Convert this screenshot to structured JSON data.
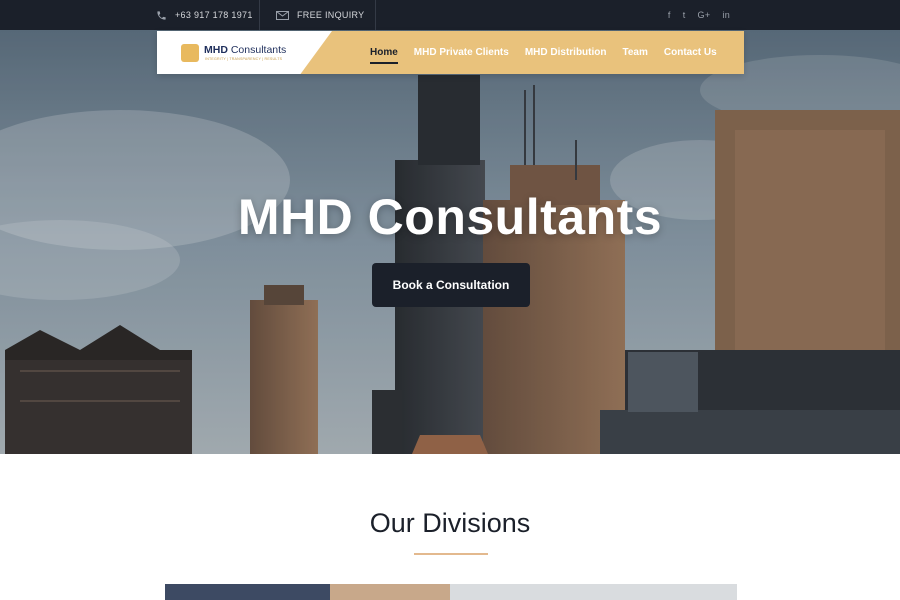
{
  "topbar": {
    "phone": "+63 917 178 1971",
    "inquiry": "FREE INQUIRY",
    "social": [
      "f",
      "t",
      "G+",
      "in"
    ]
  },
  "header": {
    "logo_brand": "MHD",
    "logo_name": "Consultants",
    "logo_tagline": "INTEGRITY | TRANSPARENCY | RESULTS",
    "nav": [
      {
        "label": "Home",
        "active": true
      },
      {
        "label": "MHD Private Clients"
      },
      {
        "label": "MHD Distribution"
      },
      {
        "label": "Team"
      },
      {
        "label": "Contact Us"
      }
    ]
  },
  "hero": {
    "title": "MHD Consultants",
    "cta": "Book a Consultation"
  },
  "divisions": {
    "title": "Our Divisions"
  },
  "colors": {
    "dark": "#1b202a",
    "gold": "#e9c27c",
    "accent_rule": "#e3b98e"
  }
}
